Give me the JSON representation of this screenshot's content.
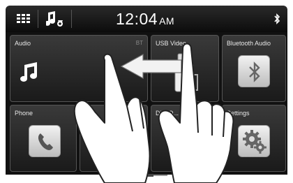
{
  "header": {
    "time": "12:04",
    "ampm": "AM",
    "icons": [
      "grid-menu-icon",
      "music-note-icon",
      "bluetooth-icon"
    ]
  },
  "tiles": {
    "audio": {
      "label": "Audio",
      "source": "BT",
      "icon": "music-note-icon"
    },
    "usb_video": {
      "label": "USB Video",
      "icon": "usb-icon"
    },
    "bluetooth_audio": {
      "label": "Bluetooth Audio",
      "icon": "bluetooth-icon"
    },
    "phone": {
      "label": "Phone",
      "icon": "phone-handset-icon"
    },
    "direct_other": {
      "label": "Di... O..."
    },
    "settings": {
      "label": "Settings",
      "icon": "gear-icon"
    }
  },
  "gesture": {
    "icon": "swipe-left-arrow-icon",
    "hands_icon": "two-hands-drag-icon"
  },
  "colors": {
    "bar": "#111111",
    "tile": "#2a2a2a",
    "text": "#e8e8e8"
  }
}
